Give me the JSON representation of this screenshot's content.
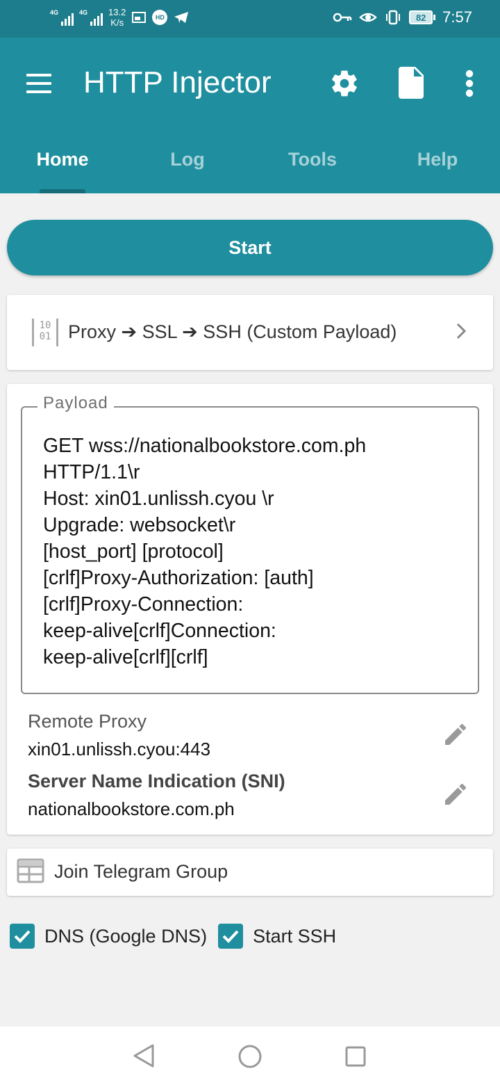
{
  "status_bar": {
    "net_tag_1": "4G",
    "net_tag_2": "4G",
    "speed_value": "13.2",
    "speed_unit": "K/s",
    "hd_badge": "HD",
    "battery": "82",
    "time": "7:57"
  },
  "app_bar": {
    "title": "HTTP Injector",
    "tabs": [
      {
        "label": "Home",
        "active": true
      },
      {
        "label": "Log",
        "active": false
      },
      {
        "label": "Tools",
        "active": false
      },
      {
        "label": "Help",
        "active": false
      }
    ]
  },
  "start_button": {
    "label": "Start"
  },
  "mode": {
    "icon_text_top": "10",
    "icon_text_bottom": "01",
    "label": "Proxy ➔ SSL ➔ SSH (Custom Payload)"
  },
  "payload": {
    "label": "Payload",
    "text": "GET wss://nationalbookstore.com.ph\nHTTP/1.1\\r\nHost: xin01.unlissh.cyou \\r\nUpgrade: websocket\\r\n[host_port] [protocol]\n[crlf]Proxy-Authorization: [auth]\n[crlf]Proxy-Connection:\nkeep-alive[crlf]Connection:\nkeep-alive[crlf][crlf]"
  },
  "remote_proxy": {
    "label": "Remote Proxy",
    "value": "xin01.unlissh.cyou:443"
  },
  "sni": {
    "label": "Server Name Indication (SNI)",
    "value": "nationalbookstore.com.ph"
  },
  "telegram": {
    "label": "Join Telegram Group"
  },
  "options": [
    {
      "label": "DNS (Google DNS)",
      "checked": true
    },
    {
      "label": "Start SSH",
      "checked": true
    }
  ],
  "colors": {
    "primary": "#1f8e9e",
    "status_bar": "#1d7d8c",
    "background": "#f1f1f1"
  }
}
